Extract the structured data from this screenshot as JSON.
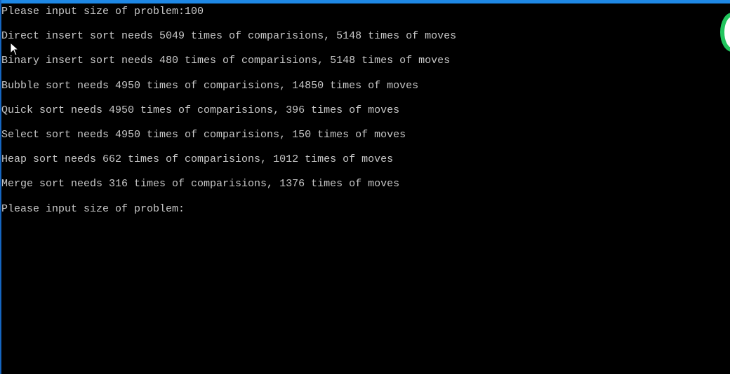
{
  "console": {
    "lines": [
      "Please input size of problem:100",
      "Direct insert sort needs 5049 times of comparisions, 5148 times of moves",
      "Binary insert sort needs 480 times of comparisions, 5148 times of moves",
      "Bubble sort needs 4950 times of comparisions, 14850 times of moves",
      "Quick sort needs 4950 times of comparisions, 396 times of moves",
      "Select sort needs 4950 times of comparisions, 150 times of moves",
      "Heap sort needs 662 times of comparisions, 1012 times of moves",
      "Merge sort needs 316 times of comparisions, 1376 times of moves",
      "Please input size of problem:"
    ]
  },
  "colors": {
    "background": "#000000",
    "text": "#c8c8c8",
    "window_border": "#1e88e5",
    "green_accent": "#22c55e"
  },
  "icons": {
    "cursor": "mouse-pointer-icon",
    "side_widget": "green-ring-icon"
  }
}
